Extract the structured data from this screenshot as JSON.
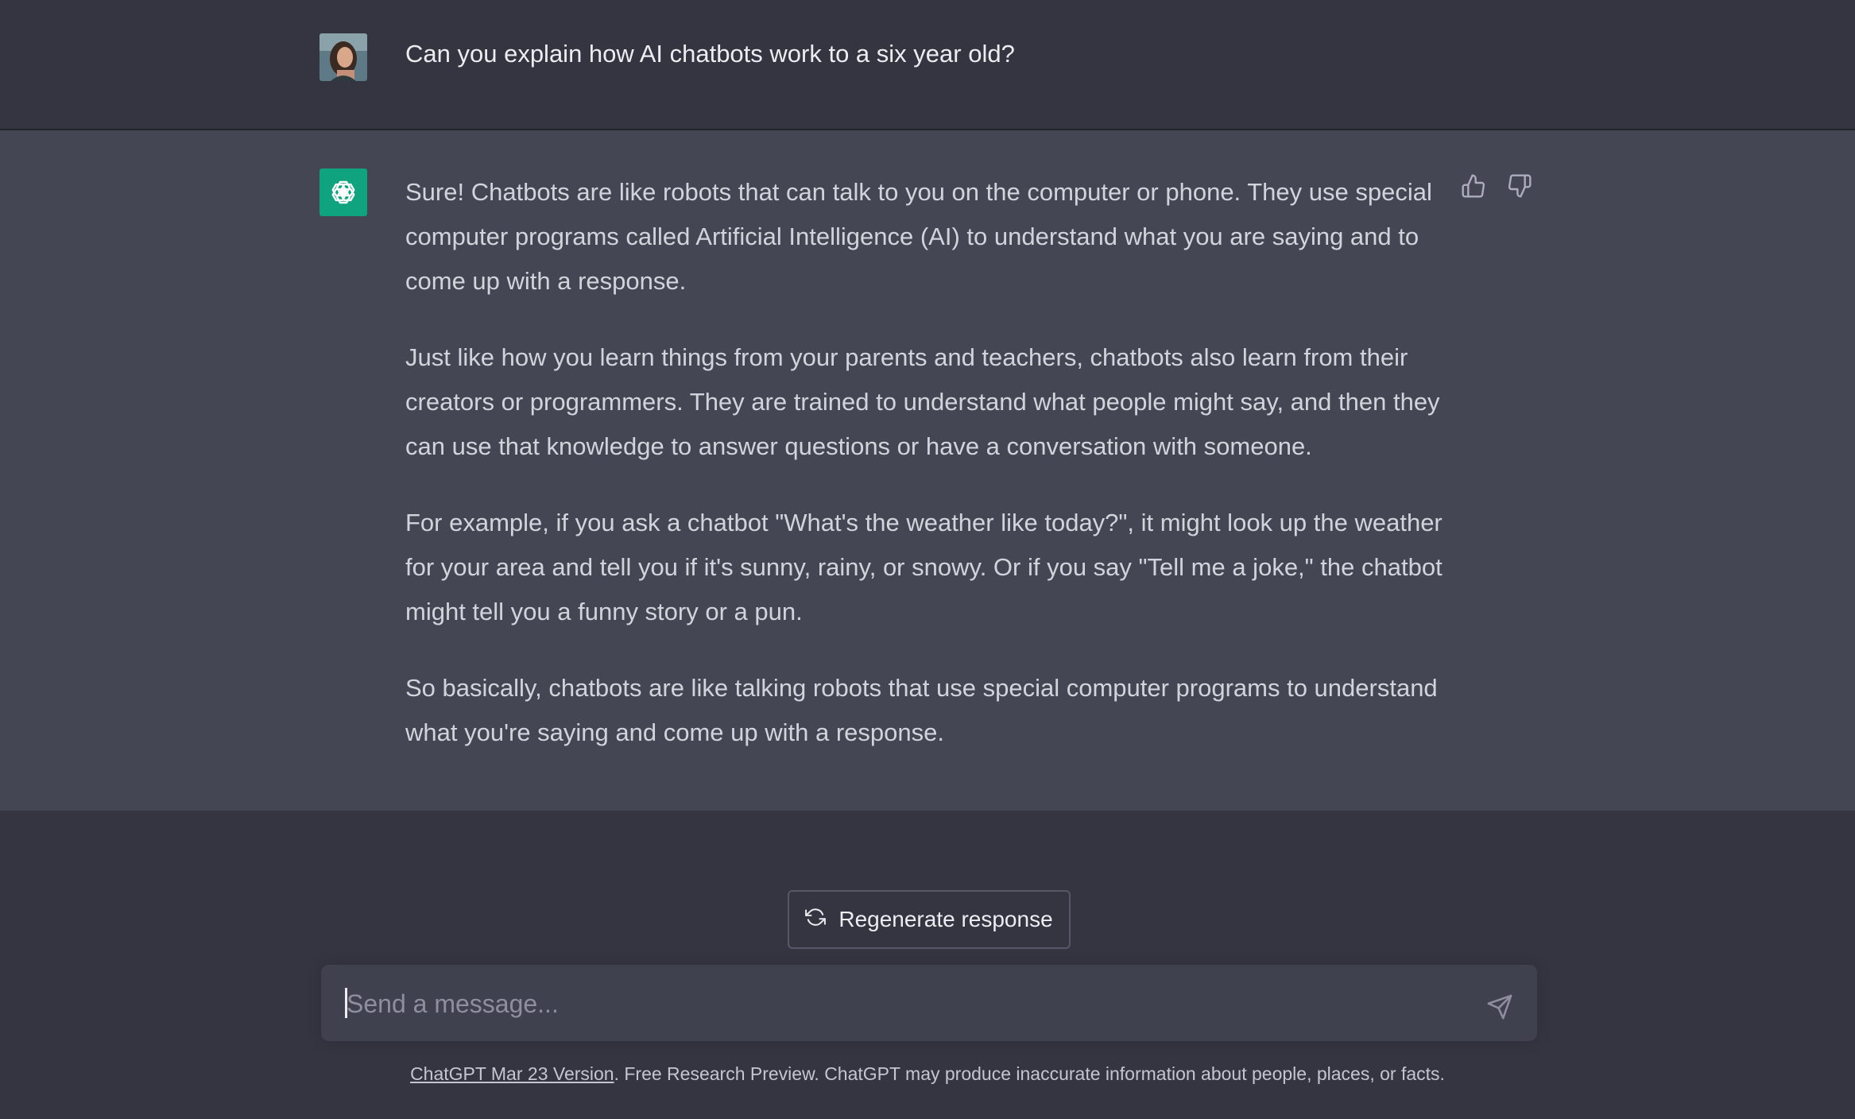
{
  "user_message": {
    "avatar": "user-photo-avatar",
    "text": "Can you explain how AI chatbots work to a six year old?"
  },
  "assistant_message": {
    "avatar": "openai-logo-icon",
    "paragraphs": [
      "Sure! Chatbots are like robots that can talk to you on the computer or phone. They use special computer programs called Artificial Intelligence (AI) to understand what you are saying and to come up with a response.",
      "Just like how you learn things from your parents and teachers, chatbots also learn from their creators or programmers. They are trained to understand what people might say, and then they can use that knowledge to answer questions or have a conversation with someone.",
      "For example, if you ask a chatbot \"What's the weather like today?\", it might look up the weather for your area and tell you if it's sunny, rainy, or snowy. Or if you say \"Tell me a joke,\" the chatbot might tell you a funny story or a pun.",
      "So basically, chatbots are like talking robots that use special computer programs to understand what you're saying and come up with a response."
    ],
    "feedback_icons": [
      "thumbs-up-icon",
      "thumbs-down-icon"
    ]
  },
  "regenerate": {
    "label": "Regenerate response",
    "icon": "refresh-icon"
  },
  "composer": {
    "placeholder": "Send a message...",
    "value": "",
    "send_icon": "send-icon"
  },
  "footer": {
    "version_link": "ChatGPT Mar 23 Version",
    "disclaimer": ". Free Research Preview. ChatGPT may produce inaccurate information about people, places, or facts."
  },
  "colors": {
    "background": "#343541",
    "assistant_background": "#444654",
    "input_background": "#40414f",
    "brand_green": "#10a37f"
  }
}
